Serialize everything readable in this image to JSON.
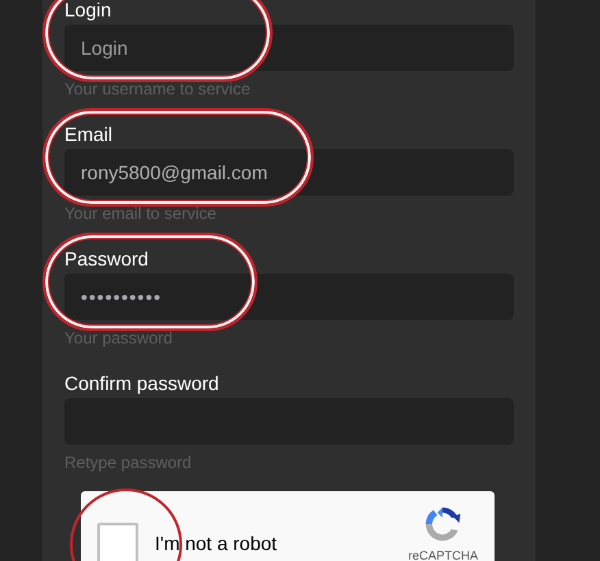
{
  "fields": [
    {
      "label": "Login",
      "placeholder": "Login",
      "hint": "Your username to service",
      "highlighted": true
    },
    {
      "label": "Email",
      "value": "rony5800@gmail.com",
      "hint": "Your email to service",
      "highlighted": true
    },
    {
      "label": "Password",
      "value": "••••••••••",
      "hint": "Your password",
      "highlighted": true
    },
    {
      "label": "Confirm password",
      "hint": "Retype password",
      "highlighted": false
    }
  ],
  "captcha": {
    "label": "I'm not a robot",
    "checked": false,
    "highlighted": true,
    "brand": "reCAPTCHA"
  }
}
